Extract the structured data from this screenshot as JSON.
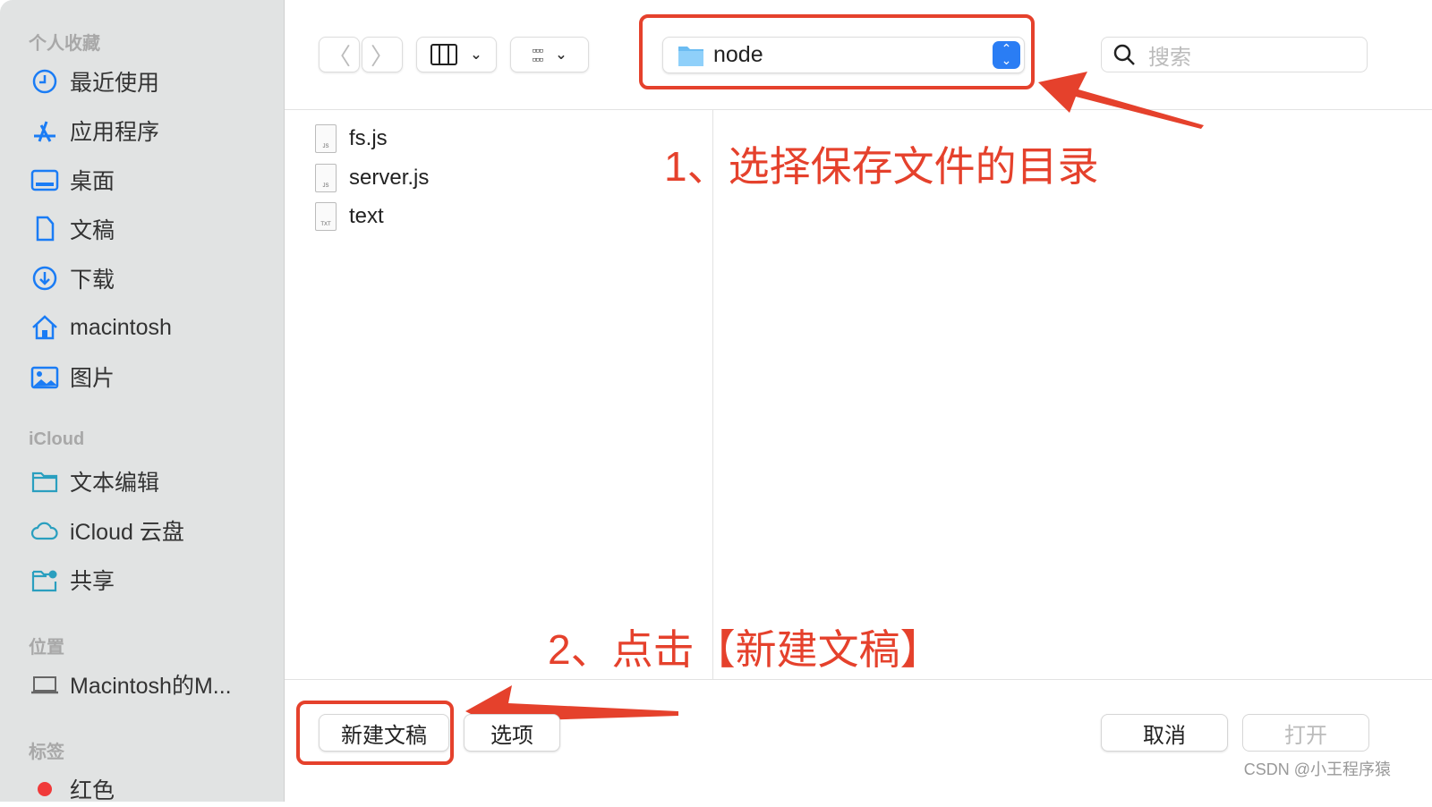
{
  "sidebar": {
    "sections": [
      {
        "title": "个人收藏",
        "items": [
          {
            "label": "最近使用",
            "icon": "clock-icon"
          },
          {
            "label": "应用程序",
            "icon": "app-store-icon"
          },
          {
            "label": "桌面",
            "icon": "desktop-icon"
          },
          {
            "label": "文稿",
            "icon": "document-icon"
          },
          {
            "label": "下载",
            "icon": "download-icon"
          },
          {
            "label": "macintosh",
            "icon": "home-icon"
          },
          {
            "label": "图片",
            "icon": "photo-icon"
          }
        ]
      },
      {
        "title": "iCloud",
        "items": [
          {
            "label": "文本编辑",
            "icon": "folder-icon"
          },
          {
            "label": "iCloud 云盘",
            "icon": "cloud-icon"
          },
          {
            "label": "共享",
            "icon": "shared-folder-icon"
          }
        ]
      },
      {
        "title": "位置",
        "items": [
          {
            "label": "Macintosh的M...",
            "icon": "laptop-icon"
          }
        ]
      },
      {
        "title": "标签",
        "items": [
          {
            "label": "红色",
            "icon": "red-tag-dot"
          }
        ]
      }
    ]
  },
  "toolbar": {
    "path": "node",
    "search_placeholder": "搜索"
  },
  "files": [
    {
      "name": "fs.js",
      "type": "JS"
    },
    {
      "name": "server.js",
      "type": "JS"
    },
    {
      "name": "text",
      "type": "TXT"
    }
  ],
  "annotations": {
    "step1": "1、选择保存文件的目录",
    "step2": "2、点击【新建文稿】",
    "color": "#e5412c"
  },
  "buttons": {
    "new_document": "新建文稿",
    "options": "选项",
    "cancel": "取消",
    "open": "打开"
  },
  "watermark": "CSDN @小王程序猿"
}
